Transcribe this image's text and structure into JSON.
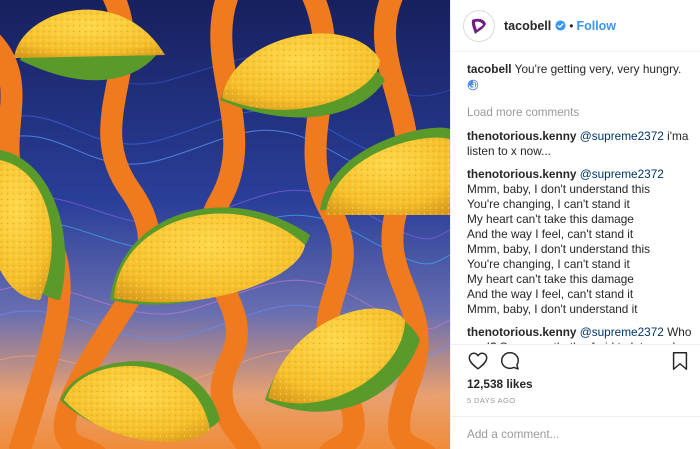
{
  "post": {
    "image_description_icon": "taco-pattern-image",
    "colors": {
      "background_top": "#1a2466",
      "background_bottom": "#f08c3a",
      "ribbon": "#f07a1e",
      "shell": "#f5c02e",
      "lettuce": "#5a9a2a",
      "accent_link": "#3897f0"
    }
  },
  "header": {
    "avatar_icon": "taco-bell-logo-icon",
    "username": "tacobell",
    "verified_icon": "verified-badge-icon",
    "dot": "•",
    "follow_label": "Follow"
  },
  "caption": {
    "user": "tacobell",
    "text": "You're getting very, very hungry.",
    "emoji_icon": "cyclone-emoji-icon"
  },
  "load_more": "Load more comments",
  "comments": [
    {
      "user": "thenotorious.kenny",
      "mention": "@supreme2372",
      "text": " i'ma listen to x now..."
    },
    {
      "user": "thenotorious.kenny",
      "mention": "@supreme2372",
      "text": " Mmm, baby, I don't understand this\nYou're changing, I can't stand it\nMy heart can't take this damage\nAnd the way I feel, can't stand it\nMmm, baby, I don't understand this\nYou're changing, I can't stand it\nMy heart can't take this damage\nAnd the way I feel, can't stand it\nMmm, baby, I don't understand it"
    },
    {
      "user": "thenotorious.kenny",
      "mention": "@supreme2372",
      "text": " Who am I? Someone that's afraid to let go, uh\nYou decide, if you're ever gonna let me know, yeah"
    }
  ],
  "actions": {
    "like_icon": "heart-icon",
    "comment_icon": "comment-icon",
    "save_icon": "bookmark-icon",
    "likes": "12,538 likes",
    "time": "5 DAYS AGO",
    "add_comment_placeholder": "Add a comment..."
  }
}
